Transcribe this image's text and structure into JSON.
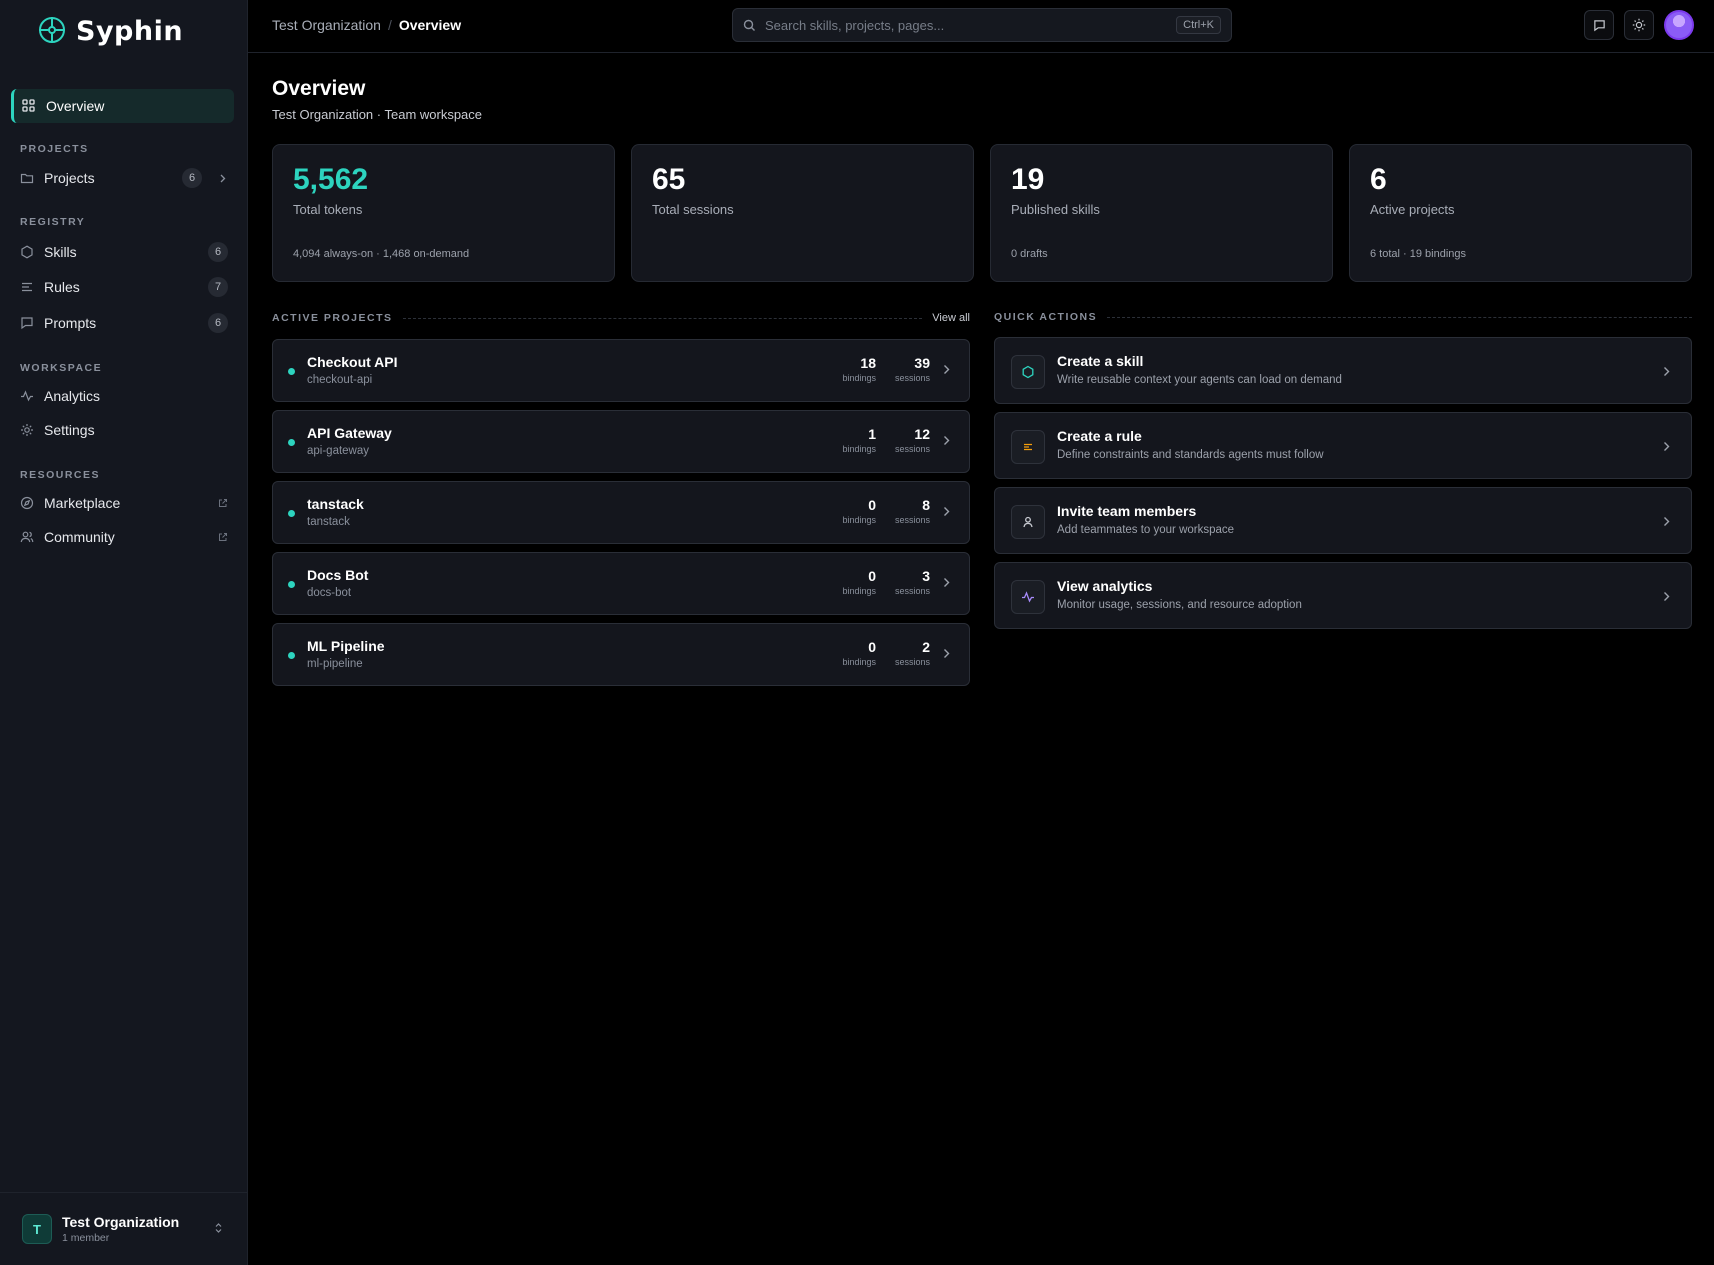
{
  "app": {
    "name": "Syphin"
  },
  "colors": {
    "accent": "#2dd4bf",
    "background": "#000000",
    "sidebar": "#14171f",
    "card": "#14161d",
    "rule_icon": "#f59e0b",
    "analytics_icon": "#a78bfa",
    "avatar": "#8b5cf6"
  },
  "sidebar": {
    "active_item": {
      "label": "Overview",
      "icon": "grid-icon"
    },
    "sections": [
      {
        "title": "PROJECTS",
        "items": [
          {
            "label": "Projects",
            "icon": "folder-icon",
            "badge": "6",
            "trailing": "chevron-right-icon"
          }
        ]
      },
      {
        "title": "REGISTRY",
        "items": [
          {
            "label": "Skills",
            "icon": "hexagon-icon",
            "badge": "6"
          },
          {
            "label": "Rules",
            "icon": "lines-icon",
            "badge": "7"
          },
          {
            "label": "Prompts",
            "icon": "message-icon",
            "badge": "6"
          }
        ]
      },
      {
        "title": "WORKSPACE",
        "items": [
          {
            "label": "Analytics",
            "icon": "activity-icon"
          },
          {
            "label": "Settings",
            "icon": "gear-icon"
          }
        ]
      },
      {
        "title": "RESOURCES",
        "items": [
          {
            "label": "Marketplace",
            "icon": "compass-icon",
            "trailing": "external-link-icon"
          },
          {
            "label": "Community",
            "icon": "users-icon",
            "trailing": "external-link-icon"
          }
        ]
      }
    ],
    "footer": {
      "avatar_letter": "T",
      "org_name": "Test Organization",
      "org_sub": "1 member"
    }
  },
  "topbar": {
    "breadcrumb": {
      "parent": "Test Organization",
      "separator": "/",
      "current": "Overview"
    },
    "search": {
      "placeholder": "Search skills, projects, pages...",
      "shortcut": "Ctrl+K"
    }
  },
  "page": {
    "title": "Overview",
    "subtitle": "Test Organization · Team workspace"
  },
  "stats": [
    {
      "value": "5,562",
      "label": "Total tokens",
      "foot": "4,094 always-on · 1,468 on-demand",
      "accent": true
    },
    {
      "value": "65",
      "label": "Total sessions",
      "foot": ""
    },
    {
      "value": "19",
      "label": "Published skills",
      "foot": "0 drafts"
    },
    {
      "value": "6",
      "label": "Active projects",
      "foot": "6 total · 19 bindings"
    }
  ],
  "active_projects": {
    "title": "ACTIVE PROJECTS",
    "view_all": "View all",
    "binding_label": "bindings",
    "session_label": "sessions",
    "items": [
      {
        "name": "Checkout API",
        "slug": "checkout-api",
        "bindings": "18",
        "sessions": "39"
      },
      {
        "name": "API Gateway",
        "slug": "api-gateway",
        "bindings": "1",
        "sessions": "12"
      },
      {
        "name": "tanstack",
        "slug": "tanstack",
        "bindings": "0",
        "sessions": "8"
      },
      {
        "name": "Docs Bot",
        "slug": "docs-bot",
        "bindings": "0",
        "sessions": "3"
      },
      {
        "name": "ML Pipeline",
        "slug": "ml-pipeline",
        "bindings": "0",
        "sessions": "2"
      }
    ]
  },
  "quick_actions": {
    "title": "QUICK ACTIONS",
    "items": [
      {
        "title": "Create a skill",
        "desc": "Write reusable context your agents can load on demand",
        "icon": "hexagon-icon"
      },
      {
        "title": "Create a rule",
        "desc": "Define constraints and standards agents must follow",
        "icon": "lines-icon"
      },
      {
        "title": "Invite team members",
        "desc": "Add teammates to your workspace",
        "icon": "user-icon"
      },
      {
        "title": "View analytics",
        "desc": "Monitor usage, sessions, and resource adoption",
        "icon": "activity-icon"
      }
    ]
  }
}
